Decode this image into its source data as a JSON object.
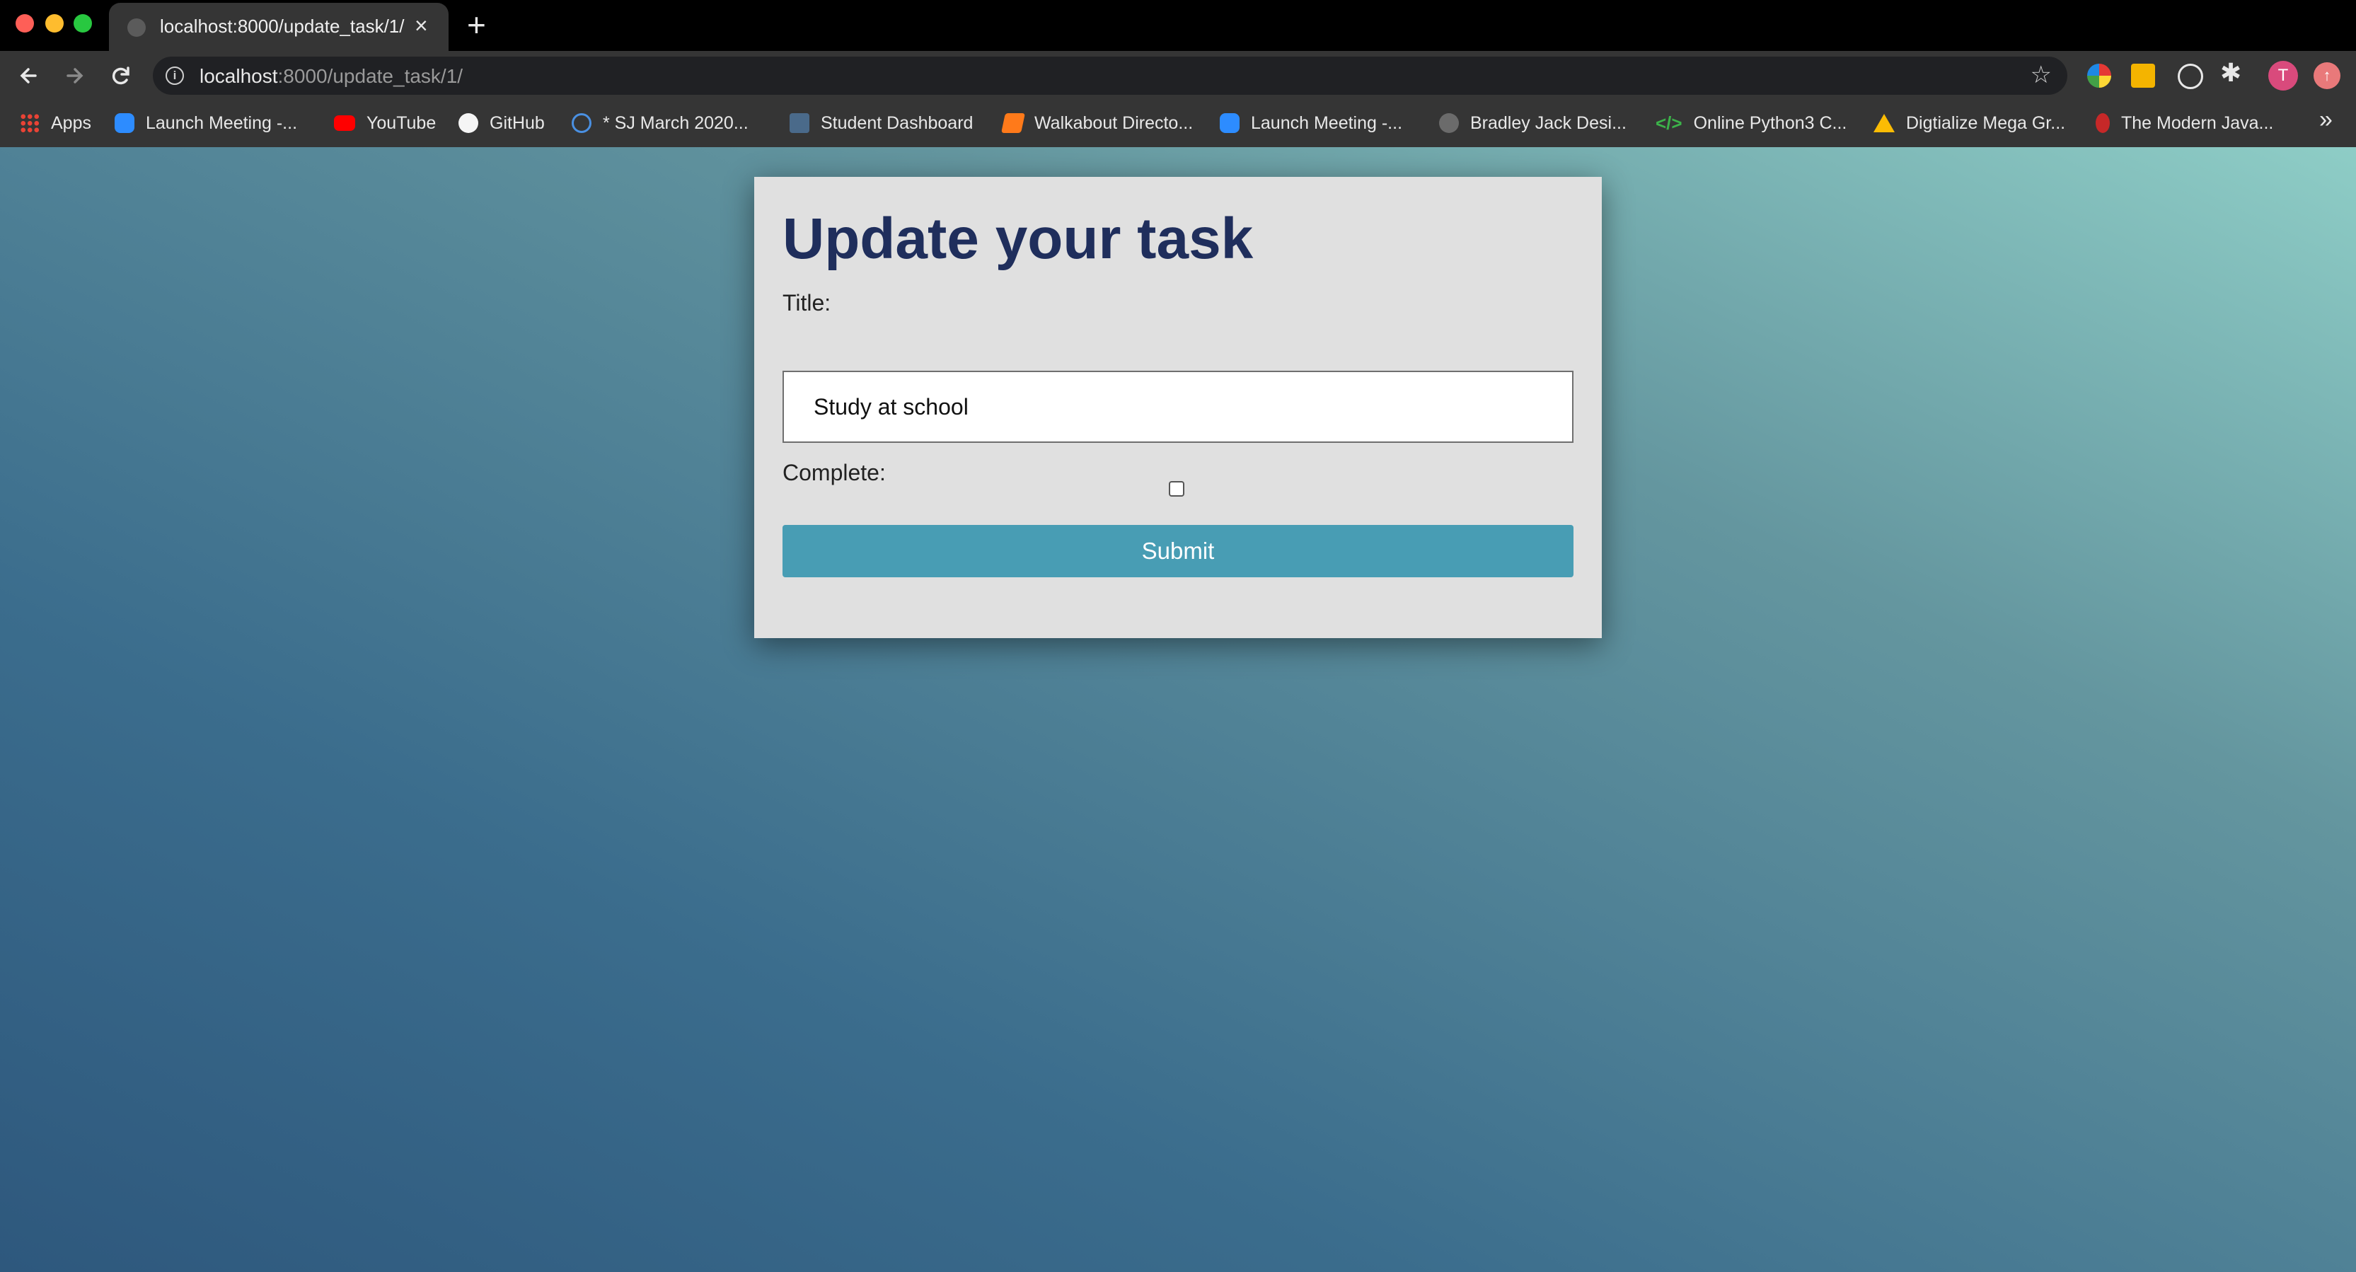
{
  "browser": {
    "tab_title": "localhost:8000/update_task/1/",
    "url_host": "localhost",
    "url_path": ":8000/update_task/1/",
    "avatar_letter": "T",
    "bookmarks": [
      {
        "label": "Apps",
        "icon": "apps-grid-icon"
      },
      {
        "label": "Launch Meeting -...",
        "icon": "zoom-icon"
      },
      {
        "label": "YouTube",
        "icon": "youtube-icon"
      },
      {
        "label": "GitHub",
        "icon": "github-icon"
      },
      {
        "label": "* SJ March 2020...",
        "icon": "circle-refresh-icon"
      },
      {
        "label": "Student Dashboard",
        "icon": "dashboard-icon"
      },
      {
        "label": "Walkabout Directo...",
        "icon": "walkabout-icon"
      },
      {
        "label": "Launch Meeting -...",
        "icon": "zoom-icon"
      },
      {
        "label": "Bradley Jack Desi...",
        "icon": "figure-icon"
      },
      {
        "label": "Online Python3 C...",
        "icon": "code-icon"
      },
      {
        "label": "Digtialize Mega Gr...",
        "icon": "google-drive-icon"
      },
      {
        "label": "The Modern Java...",
        "icon": "figure-red-icon"
      }
    ],
    "more_bookmarks": "»"
  },
  "form": {
    "heading": "Update your task",
    "title_label": "Title:",
    "title_value": "Study at school",
    "complete_label": "Complete:",
    "complete_checked": false,
    "submit_label": "Submit"
  },
  "colors": {
    "heading": "#1f2e5c",
    "submit_button": "#489db4",
    "card_background": "#e0e0e0"
  }
}
